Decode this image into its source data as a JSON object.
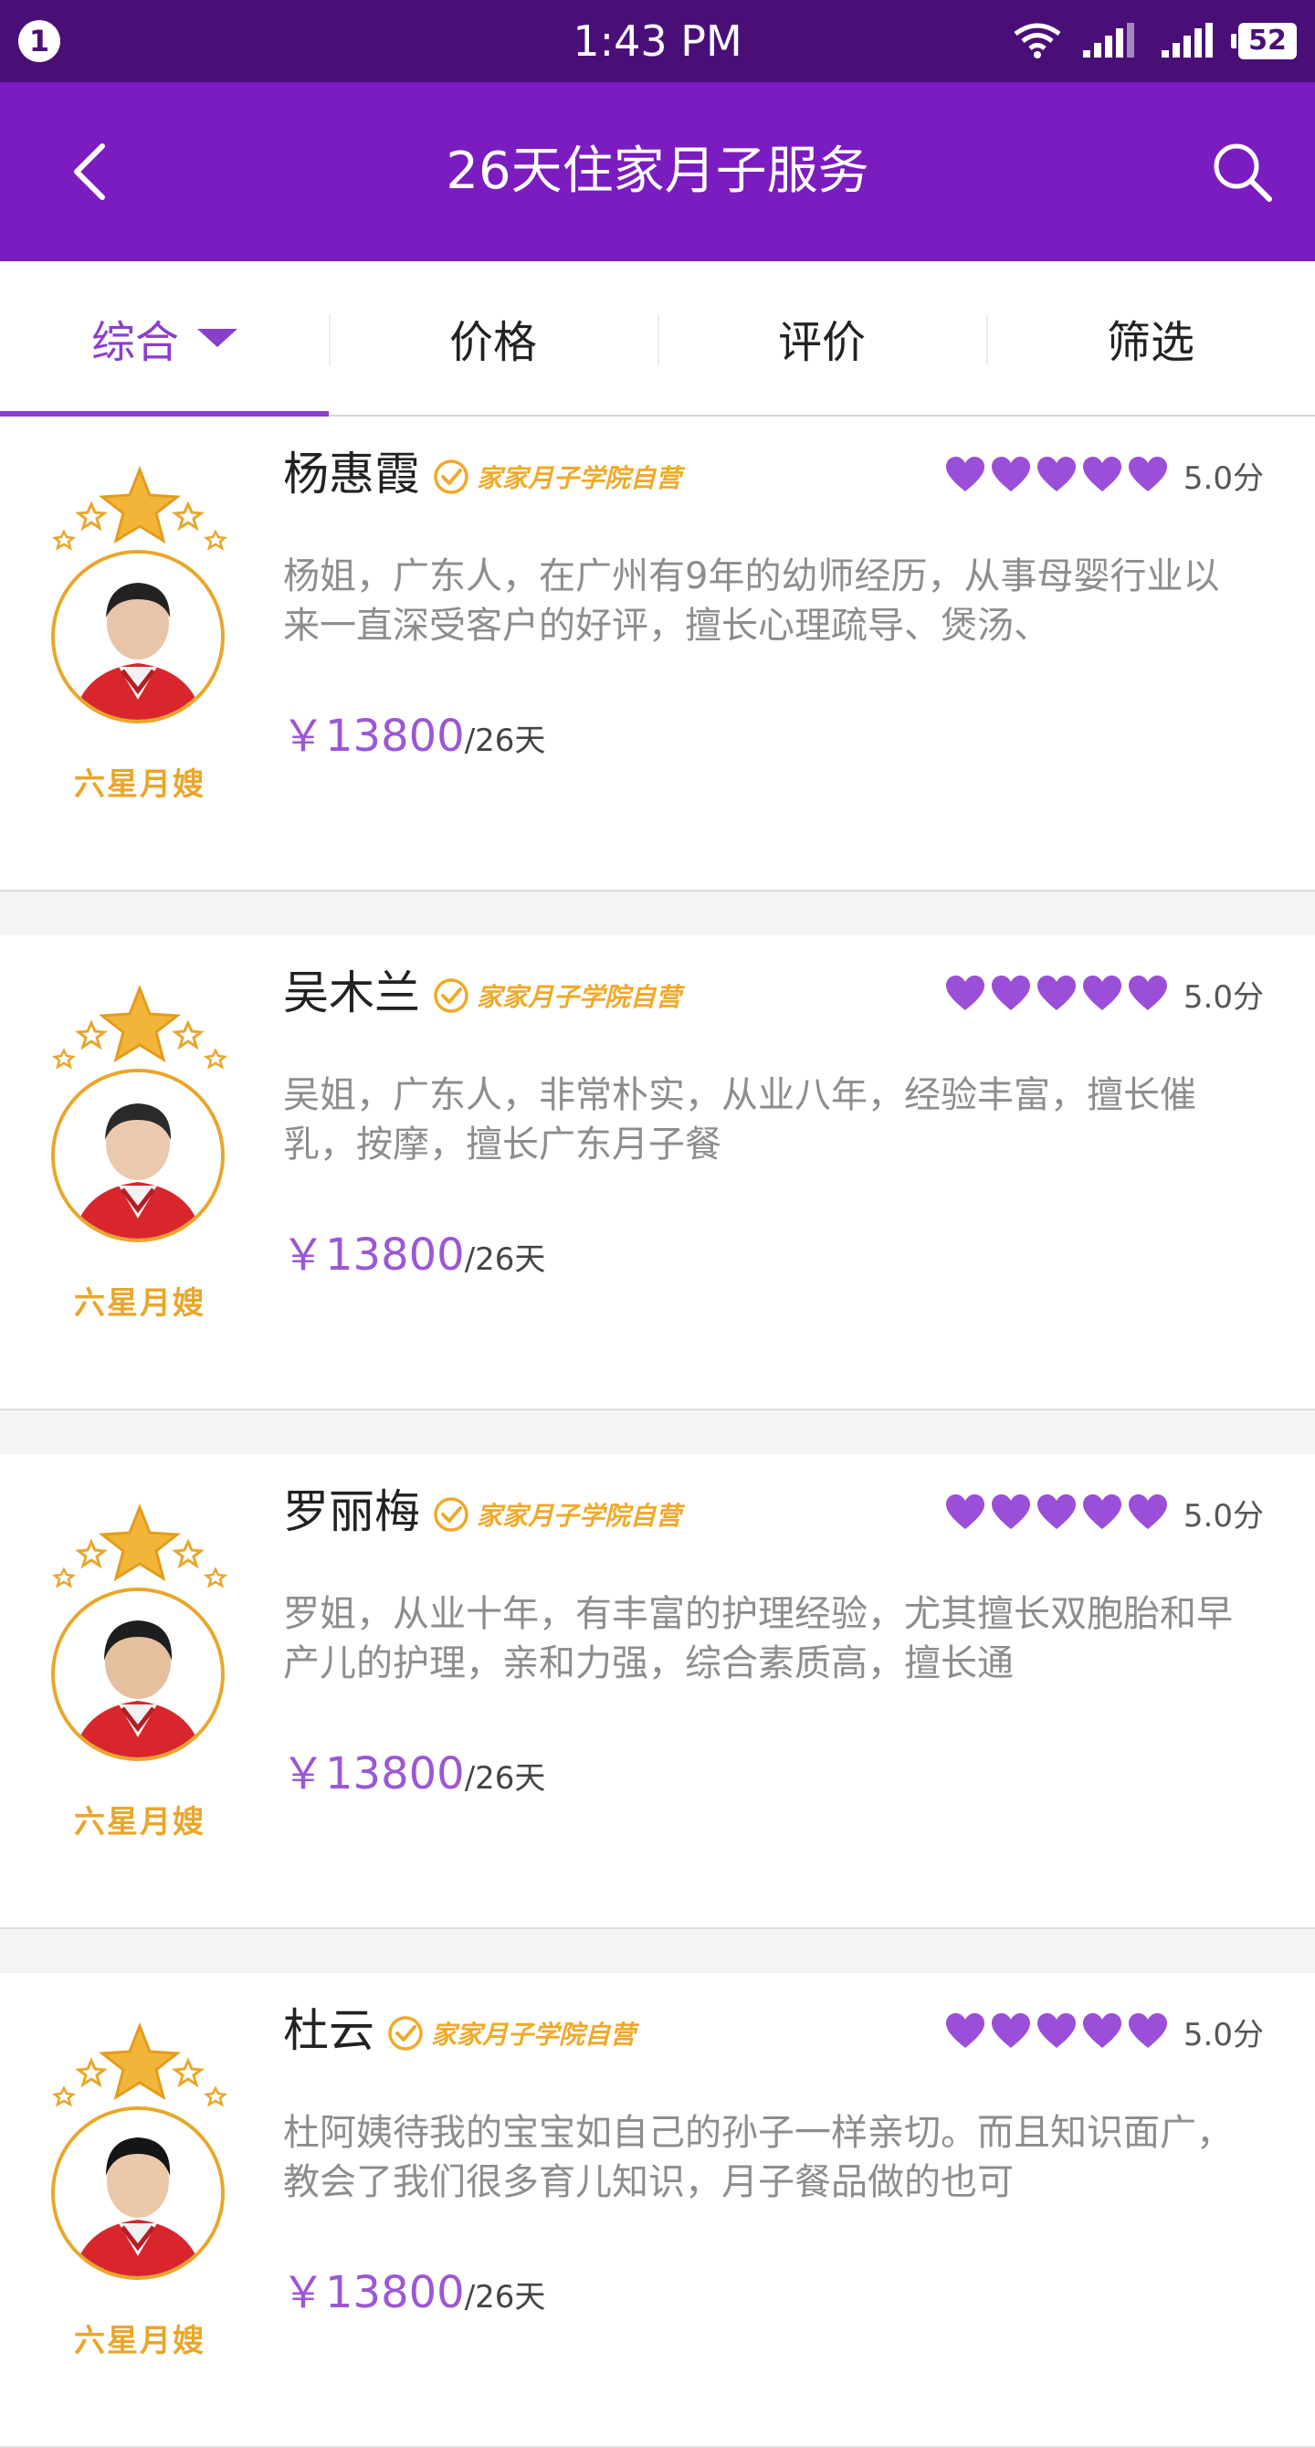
{
  "status_bar": {
    "notification_count": "1",
    "time": "1:43 PM",
    "battery": "52",
    "icons": [
      "wifi-icon",
      "signal-icon",
      "signal-icon"
    ]
  },
  "header": {
    "title": "26天住家月子服务",
    "back_icon": "back-icon",
    "search_icon": "search-icon"
  },
  "tabs": [
    {
      "label": "综合"
    },
    {
      "label": "价格"
    },
    {
      "label": "评价"
    },
    {
      "label": "筛选"
    }
  ],
  "badge_label": "六星月嫂",
  "certification_label": "家家月子学院自营",
  "accent_color": "#8a3fcc",
  "listings": [
    {
      "name": "杨惠霞",
      "rating": 5,
      "score": "5.0分",
      "description": "杨姐，广东人，在广州有9年的幼师经历，从事母婴行业以来一直深受客户的好评，擅长心理疏导、煲汤、",
      "price": "￥13800",
      "price_unit": "/26天"
    },
    {
      "name": "吴木兰",
      "rating": 5,
      "score": "5.0分",
      "description": "吴姐，广东人，非常朴实，从业八年，经验丰富，擅长催乳，按摩，擅长广东月子餐",
      "price": "￥13800",
      "price_unit": "/26天"
    },
    {
      "name": "罗丽梅",
      "rating": 5,
      "score": "5.0分",
      "description": "罗姐，从业十年，有丰富的护理经验，尤其擅长双胞胎和早产儿的护理，亲和力强，综合素质高，擅长通",
      "price": "￥13800",
      "price_unit": "/26天"
    },
    {
      "name": "杜云",
      "rating": 5,
      "score": "5.0分",
      "description": "杜阿姨待我的宝宝如自己的孙子一样亲切。而且知识面广，教会了我们很多育儿知识，月子餐品做的也可",
      "price": "￥13800",
      "price_unit": "/26天"
    }
  ]
}
